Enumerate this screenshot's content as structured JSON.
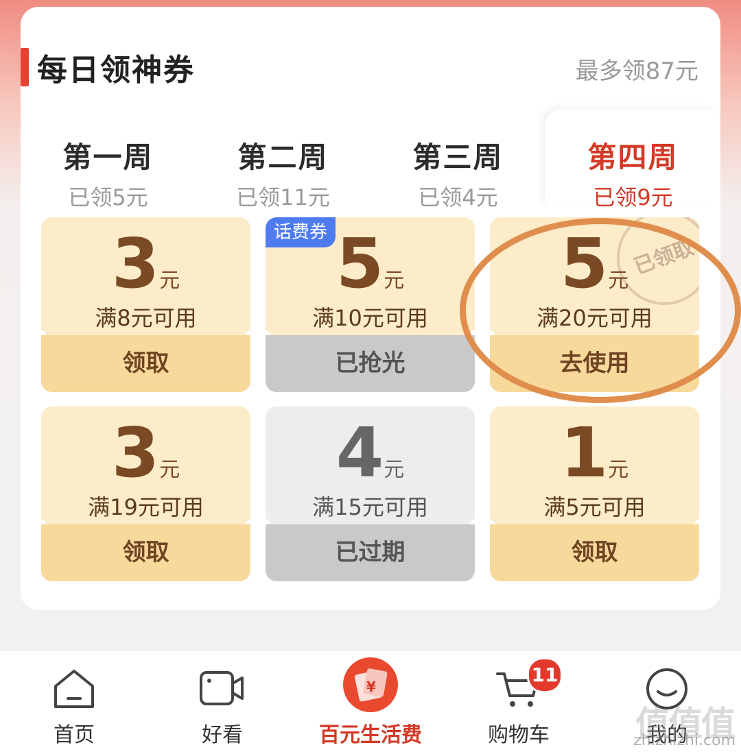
{
  "header": {
    "title": "每日领神券",
    "max_text": "最多领87元"
  },
  "tabs": [
    {
      "week": "第一周",
      "sub": "已领5元"
    },
    {
      "week": "第二周",
      "sub": "已领11元"
    },
    {
      "week": "第三周",
      "sub": "已领4元"
    },
    {
      "week": "第四周",
      "sub": "已领9元",
      "active": true
    }
  ],
  "coupons": [
    {
      "amount": "3",
      "unit": "元",
      "condition": "满8元可用",
      "action": "领取"
    },
    {
      "amount": "5",
      "unit": "元",
      "condition": "满10元可用",
      "action": "已抢光",
      "tag": "话费券"
    },
    {
      "amount": "5",
      "unit": "元",
      "condition": "满20元可用",
      "action": "去使用",
      "stamp": "已领取"
    },
    {
      "amount": "3",
      "unit": "元",
      "condition": "满19元可用",
      "action": "领取"
    },
    {
      "amount": "4",
      "unit": "元",
      "condition": "满15元可用",
      "action": "已过期"
    },
    {
      "amount": "1",
      "unit": "元",
      "condition": "满5元可用",
      "action": "领取"
    }
  ],
  "nav": [
    {
      "label": "首页",
      "icon": "home-icon"
    },
    {
      "label": "好看",
      "icon": "video-icon"
    },
    {
      "label": "百元生活费",
      "icon": "red-envelope-icon",
      "active": true
    },
    {
      "label": "购物车",
      "icon": "cart-icon",
      "badge": "11"
    },
    {
      "label": "我的",
      "icon": "profile-icon"
    }
  ],
  "watermark": {
    "brand": "值值值",
    "site": "zhizhizhi.com"
  },
  "colors": {
    "accent": "#d23a27",
    "coupon_bg": "#fdecc9",
    "action_bg": "#f8d99c",
    "tag_blue": "#4e7cf0"
  }
}
